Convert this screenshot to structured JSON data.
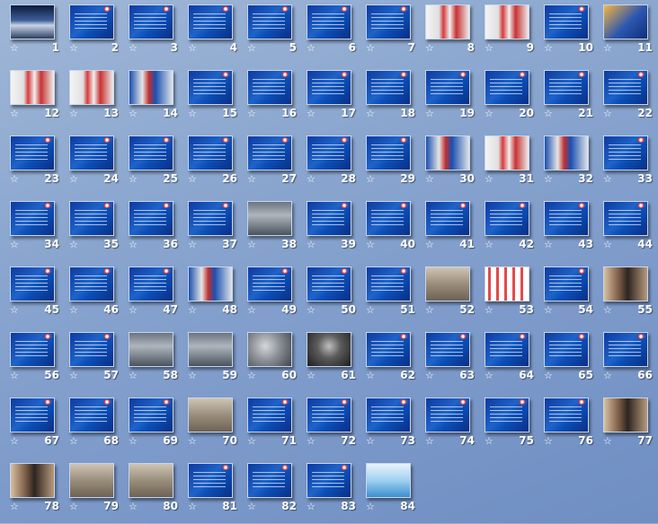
{
  "icons": {
    "transition_icon": "star-outline-icon"
  },
  "slides": [
    {
      "n": "1",
      "kind": "photo-stadium"
    },
    {
      "n": "2",
      "kind": "plain"
    },
    {
      "n": "3",
      "kind": "plain"
    },
    {
      "n": "4",
      "kind": "plain"
    },
    {
      "n": "5",
      "kind": "plain"
    },
    {
      "n": "6",
      "kind": "plain"
    },
    {
      "n": "7",
      "kind": "plain"
    },
    {
      "n": "8",
      "kind": "photo-red"
    },
    {
      "n": "9",
      "kind": "photo-red"
    },
    {
      "n": "10",
      "kind": "plain"
    },
    {
      "n": "11",
      "kind": "photo-orange"
    },
    {
      "n": "12",
      "kind": "photo-red"
    },
    {
      "n": "13",
      "kind": "photo-red"
    },
    {
      "n": "14",
      "kind": "photo-blue-red"
    },
    {
      "n": "15",
      "kind": "plain"
    },
    {
      "n": "16",
      "kind": "plain"
    },
    {
      "n": "17",
      "kind": "plain"
    },
    {
      "n": "18",
      "kind": "plain"
    },
    {
      "n": "19",
      "kind": "plain"
    },
    {
      "n": "20",
      "kind": "plain"
    },
    {
      "n": "21",
      "kind": "plain"
    },
    {
      "n": "22",
      "kind": "plain"
    },
    {
      "n": "23",
      "kind": "plain"
    },
    {
      "n": "24",
      "kind": "plain"
    },
    {
      "n": "25",
      "kind": "plain"
    },
    {
      "n": "26",
      "kind": "plain"
    },
    {
      "n": "27",
      "kind": "plain"
    },
    {
      "n": "28",
      "kind": "plain"
    },
    {
      "n": "29",
      "kind": "plain"
    },
    {
      "n": "30",
      "kind": "photo-blue-red"
    },
    {
      "n": "31",
      "kind": "photo-red"
    },
    {
      "n": "32",
      "kind": "photo-blue-red"
    },
    {
      "n": "33",
      "kind": "plain"
    },
    {
      "n": "34",
      "kind": "plain"
    },
    {
      "n": "35",
      "kind": "plain"
    },
    {
      "n": "36",
      "kind": "plain"
    },
    {
      "n": "37",
      "kind": "plain"
    },
    {
      "n": "38",
      "kind": "photo-dark"
    },
    {
      "n": "39",
      "kind": "plain"
    },
    {
      "n": "40",
      "kind": "plain"
    },
    {
      "n": "41",
      "kind": "plain"
    },
    {
      "n": "42",
      "kind": "plain"
    },
    {
      "n": "43",
      "kind": "plain"
    },
    {
      "n": "44",
      "kind": "plain"
    },
    {
      "n": "45",
      "kind": "plain"
    },
    {
      "n": "46",
      "kind": "plain"
    },
    {
      "n": "47",
      "kind": "plain"
    },
    {
      "n": "48",
      "kind": "photo-blue-red"
    },
    {
      "n": "49",
      "kind": "plain"
    },
    {
      "n": "50",
      "kind": "plain"
    },
    {
      "n": "51",
      "kind": "plain"
    },
    {
      "n": "52",
      "kind": "photo-room"
    },
    {
      "n": "53",
      "kind": "photo-grid"
    },
    {
      "n": "54",
      "kind": "plain"
    },
    {
      "n": "55",
      "kind": "photo-people"
    },
    {
      "n": "56",
      "kind": "plain"
    },
    {
      "n": "57",
      "kind": "plain"
    },
    {
      "n": "58",
      "kind": "photo-dark"
    },
    {
      "n": "59",
      "kind": "photo-dark"
    },
    {
      "n": "60",
      "kind": "photo-smoke"
    },
    {
      "n": "61",
      "kind": "photo-black"
    },
    {
      "n": "62",
      "kind": "plain"
    },
    {
      "n": "63",
      "kind": "plain"
    },
    {
      "n": "64",
      "kind": "plain"
    },
    {
      "n": "65",
      "kind": "plain"
    },
    {
      "n": "66",
      "kind": "plain"
    },
    {
      "n": "67",
      "kind": "plain"
    },
    {
      "n": "68",
      "kind": "plain"
    },
    {
      "n": "69",
      "kind": "plain"
    },
    {
      "n": "70",
      "kind": "photo-room"
    },
    {
      "n": "71",
      "kind": "plain"
    },
    {
      "n": "72",
      "kind": "plain"
    },
    {
      "n": "73",
      "kind": "plain"
    },
    {
      "n": "74",
      "kind": "plain"
    },
    {
      "n": "75",
      "kind": "plain"
    },
    {
      "n": "76",
      "kind": "plain"
    },
    {
      "n": "77",
      "kind": "photo-people"
    },
    {
      "n": "78",
      "kind": "photo-people"
    },
    {
      "n": "79",
      "kind": "photo-room"
    },
    {
      "n": "80",
      "kind": "photo-room"
    },
    {
      "n": "81",
      "kind": "plain"
    },
    {
      "n": "82",
      "kind": "plain"
    },
    {
      "n": "83",
      "kind": "plain"
    },
    {
      "n": "84",
      "kind": "photo-end"
    }
  ]
}
